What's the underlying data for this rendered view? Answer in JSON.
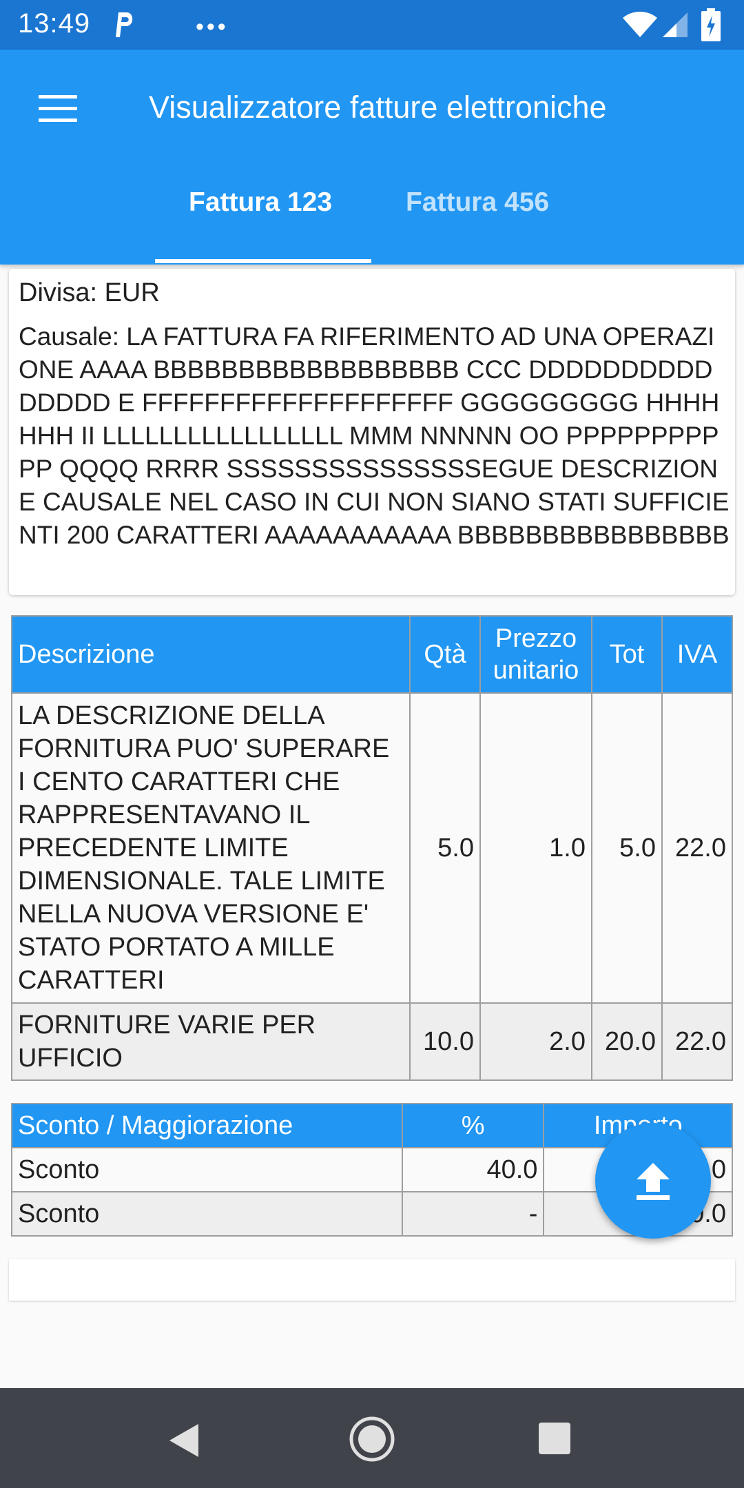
{
  "status_bar": {
    "time": "13:49",
    "dots": "•••",
    "icons": [
      "p-icon",
      "wifi-icon",
      "signal-icon",
      "battery-icon"
    ]
  },
  "app_bar": {
    "title": "Visualizzatore fatture elettroniche",
    "tabs": [
      {
        "label": "Fattura 123",
        "selected": true
      },
      {
        "label": "Fattura 456",
        "selected": false
      }
    ]
  },
  "header_card": {
    "divisa": "Divisa: EUR",
    "causale": "Causale: LA FATTURA FA RIFERIMENTO AD UNA OPERAZIONE AAAA BBBBBBBBBBBBBBBBBB CCC DDDDDDDDDDDDDDD E FFFFFFFFFFFFFFFFFFFF GGGGGGGGG HHHHHHH II LLLLLLLLLLLLLLLLL MMM NNNNN OO PPPPPPPPPPP QQQQ RRRR SSSSSSSSSSSSSSSEGUE DESCRIZIONE CAUSALE NEL CASO IN CUI NON SIANO STATI SUFFICIENTI 200 CARATTERI AAAAAAAAAAA BBBBBBBBBBBBBBBB"
  },
  "items_table": {
    "headers": {
      "descrizione": "Descrizione",
      "qta": "Qtà",
      "prezzo": "Prezzo unitario",
      "tot": "Tot",
      "iva": "IVA"
    },
    "rows": [
      {
        "descrizione": "LA DESCRIZIONE DELLA FORNITURA PUO' SUPERARE I CENTO CARATTERI CHE RAPPRESENTAVANO IL PRECEDENTE LIMITE DIMENSIONALE. TALE LIMITE NELLA NUOVA VERSIONE E' STATO PORTATO A MILLE CARATTERI",
        "qta": "5.0",
        "prezzo": "1.0",
        "tot": "5.0",
        "iva": "22.0"
      },
      {
        "descrizione": "FORNITURE VARIE PER UFFICIO",
        "qta": "10.0",
        "prezzo": "2.0",
        "tot": "20.0",
        "iva": "22.0"
      }
    ]
  },
  "discount_table": {
    "headers": {
      "tipo": "Sconto / Maggiorazione",
      "percent": "%",
      "importo": "Importo"
    },
    "rows": [
      {
        "tipo": "Sconto",
        "percent": "40.0",
        "importo": "0"
      },
      {
        "tipo": "Sconto",
        "percent": "-",
        "importo": "0.0"
      }
    ]
  },
  "fab": {
    "icon": "upload-icon"
  },
  "nav_bar": {
    "icons": [
      "back-icon",
      "home-icon",
      "recents-icon"
    ]
  },
  "colors": {
    "primary": "#2196f3",
    "status_bar": "#1b76d2",
    "nav_bar": "#404349"
  }
}
